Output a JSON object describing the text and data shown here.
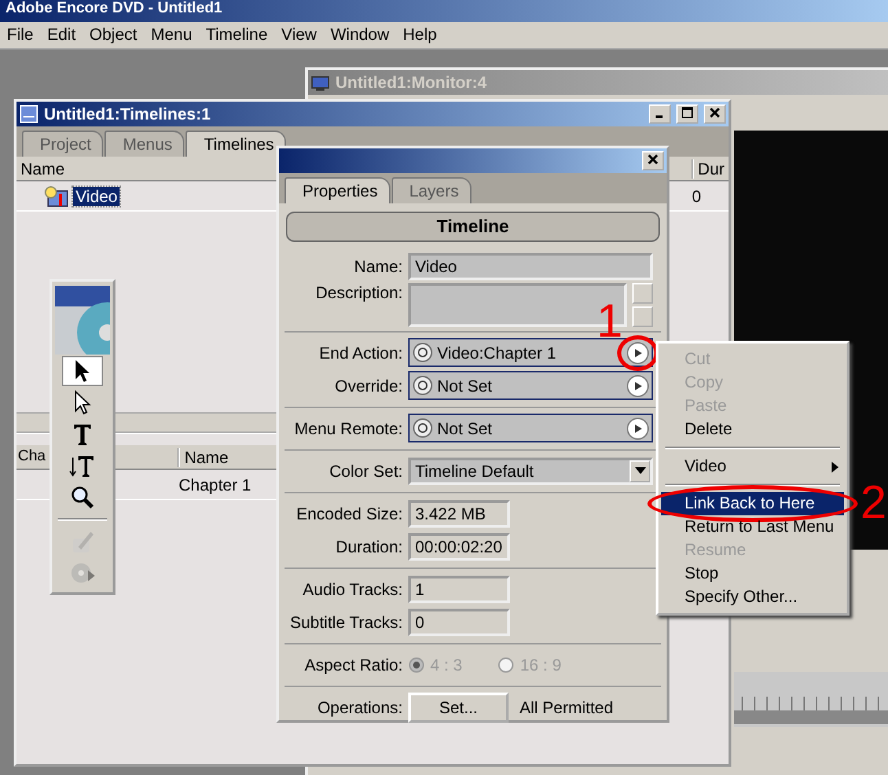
{
  "app": {
    "title": "Adobe Encore DVD - Untitled1",
    "menus": [
      "File",
      "Edit",
      "Object",
      "Menu",
      "Timeline",
      "View",
      "Window",
      "Help"
    ]
  },
  "monitor_window": {
    "title": "Untitled1:Monitor:4"
  },
  "timelines_window": {
    "title": "Untitled1:Timelines:1",
    "tabs": [
      {
        "label": "Project",
        "selected": false
      },
      {
        "label": "Menus",
        "selected": false
      },
      {
        "label": "Timelines",
        "selected": true
      }
    ],
    "columns": [
      "Name",
      "Dur"
    ],
    "rows": [
      {
        "name": "Video",
        "duration": "0",
        "selected": true
      }
    ],
    "chapter_columns": [
      "Cha",
      "Name"
    ],
    "chapter_rows": [
      {
        "name": "Chapter 1",
        "selected": false
      }
    ]
  },
  "toolbox": {
    "tools": [
      {
        "kind": "select",
        "selected": true,
        "disabled": false
      },
      {
        "kind": "direct-select",
        "selected": false,
        "disabled": false
      },
      {
        "kind": "text",
        "selected": false,
        "disabled": false
      },
      {
        "kind": "vertical-text",
        "selected": false,
        "disabled": false
      },
      {
        "kind": "zoom",
        "selected": false,
        "disabled": false
      },
      {
        "kind": "separator"
      },
      {
        "kind": "edit",
        "selected": false,
        "disabled": true
      },
      {
        "kind": "preview",
        "selected": false,
        "disabled": true
      }
    ]
  },
  "properties_panel": {
    "tabs": [
      {
        "label": "Properties",
        "selected": true
      },
      {
        "label": "Layers",
        "selected": false
      }
    ],
    "header": "Timeline",
    "groups": [
      [
        {
          "kind": "text",
          "label": "Name:",
          "value": "Video"
        },
        {
          "kind": "textarea",
          "label": "Description:"
        }
      ],
      [
        {
          "kind": "action",
          "label": "End Action:",
          "value": "Video:Chapter 1",
          "annotation": "1"
        },
        {
          "kind": "action",
          "label": "Override:",
          "value": "Not Set"
        }
      ],
      [
        {
          "kind": "action",
          "label": "Menu Remote:",
          "value": "Not Set"
        }
      ],
      [
        {
          "kind": "dropdown",
          "label": "Color Set:",
          "value": "Timeline Default"
        }
      ],
      [
        {
          "kind": "readonly",
          "label": "Encoded Size:",
          "value": "3.422 MB"
        },
        {
          "kind": "readonly",
          "label": "Duration:",
          "value": "00:00:02:20"
        }
      ],
      [
        {
          "kind": "readonly",
          "label": "Audio Tracks:",
          "value": "1"
        },
        {
          "kind": "readonly",
          "label": "Subtitle Tracks:",
          "value": "0"
        }
      ],
      [
        {
          "kind": "radio",
          "label": "Aspect Ratio:",
          "disabled": true,
          "options": [
            {
              "label": "4 : 3",
              "selected": true
            },
            {
              "label": "16 : 9",
              "selected": false
            }
          ]
        }
      ],
      [
        {
          "kind": "button",
          "label": "Operations:",
          "value": "Set...",
          "note": "All Permitted"
        }
      ]
    ]
  },
  "context_menu": {
    "items": [
      {
        "kind": "item",
        "label": "Cut",
        "disabled": true,
        "selected": false
      },
      {
        "kind": "item",
        "label": "Copy",
        "disabled": true,
        "selected": false
      },
      {
        "kind": "item",
        "label": "Paste",
        "disabled": true,
        "selected": false
      },
      {
        "kind": "item",
        "label": "Delete",
        "disabled": false,
        "selected": false
      },
      {
        "kind": "separator"
      },
      {
        "kind": "submenu",
        "label": "Video",
        "disabled": false,
        "selected": false
      },
      {
        "kind": "separator"
      },
      {
        "kind": "item",
        "label": "Link Back to Here",
        "disabled": false,
        "selected": true,
        "annotation": "2"
      },
      {
        "kind": "item",
        "label": "Return to Last Menu",
        "disabled": false,
        "selected": false
      },
      {
        "kind": "item",
        "label": "Resume",
        "disabled": true,
        "selected": false
      },
      {
        "kind": "item",
        "label": "Stop",
        "disabled": false,
        "selected": false
      },
      {
        "kind": "item",
        "label": "Specify Other...",
        "disabled": false,
        "selected": false
      }
    ]
  }
}
